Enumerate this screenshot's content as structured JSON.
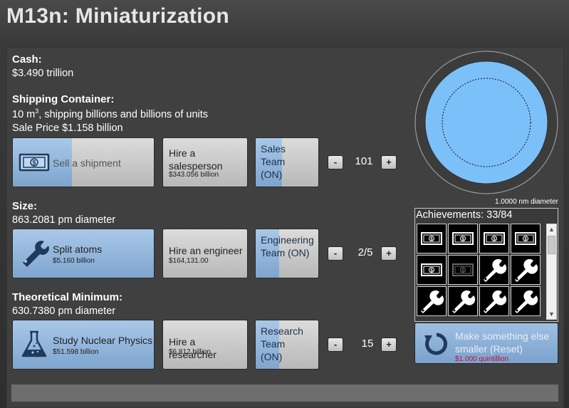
{
  "title": "M13n: Miniaturization",
  "cash": {
    "label": "Cash:",
    "value": "$3.490 trillion"
  },
  "shipping": {
    "label": "Shipping Container:",
    "volume": "10 m",
    "volume_exp": "3",
    "desc_suffix": ", shipping billions and billions of units",
    "sale_price": "Sale Price $1.158 billion"
  },
  "sell": {
    "label": "Sell a shipment",
    "progress": 0.42
  },
  "sales": {
    "hire_label": "Hire a salesperson",
    "hire_price": "$343.056 billion",
    "team_label": "Sales Team (ON)",
    "team_progress": 0.42,
    "count": "101",
    "minus": "-",
    "plus": "+"
  },
  "size": {
    "label": "Size:",
    "value": "863.2081 pm diameter"
  },
  "split": {
    "label": "Split atoms",
    "price": "$5.160 billion"
  },
  "engineering": {
    "hire_label": "Hire an engineer",
    "hire_price": "$164,131.00",
    "team_label": "Engineering Team (ON)",
    "team_progress": 0.38,
    "count": "2/5",
    "minus": "-",
    "plus": "+"
  },
  "theoretical": {
    "label": "Theoretical Minimum:",
    "value": "630.7380 pm diameter"
  },
  "study": {
    "label": "Study Nuclear Physics",
    "price": "$51.598 billion"
  },
  "research": {
    "hire_label": "Hire a researcher",
    "hire_price": "$6.812 billion",
    "team_label": "Research Team (ON)",
    "team_progress": 0.38,
    "count": "15",
    "minus": "-",
    "plus": "+"
  },
  "circle": {
    "caption": "1.0000 nm diameter",
    "fill_color": "#7cc0fa"
  },
  "achievements": {
    "title": "Achievements: 33/84",
    "icons": [
      "money-icon",
      "money-icon",
      "money-icon",
      "money-icon",
      "money-icon",
      "money-dim-icon",
      "wrench-icon",
      "wrench-icon",
      "wrench-icon",
      "wrench-icon",
      "wrench-icon",
      "wrench-icon"
    ]
  },
  "reset": {
    "label": "Make something else smaller (Reset)",
    "price": "$1.000 quintillion"
  },
  "colors": {
    "accent_blue": "#7ea5cf",
    "price_red": "#c0103a"
  }
}
